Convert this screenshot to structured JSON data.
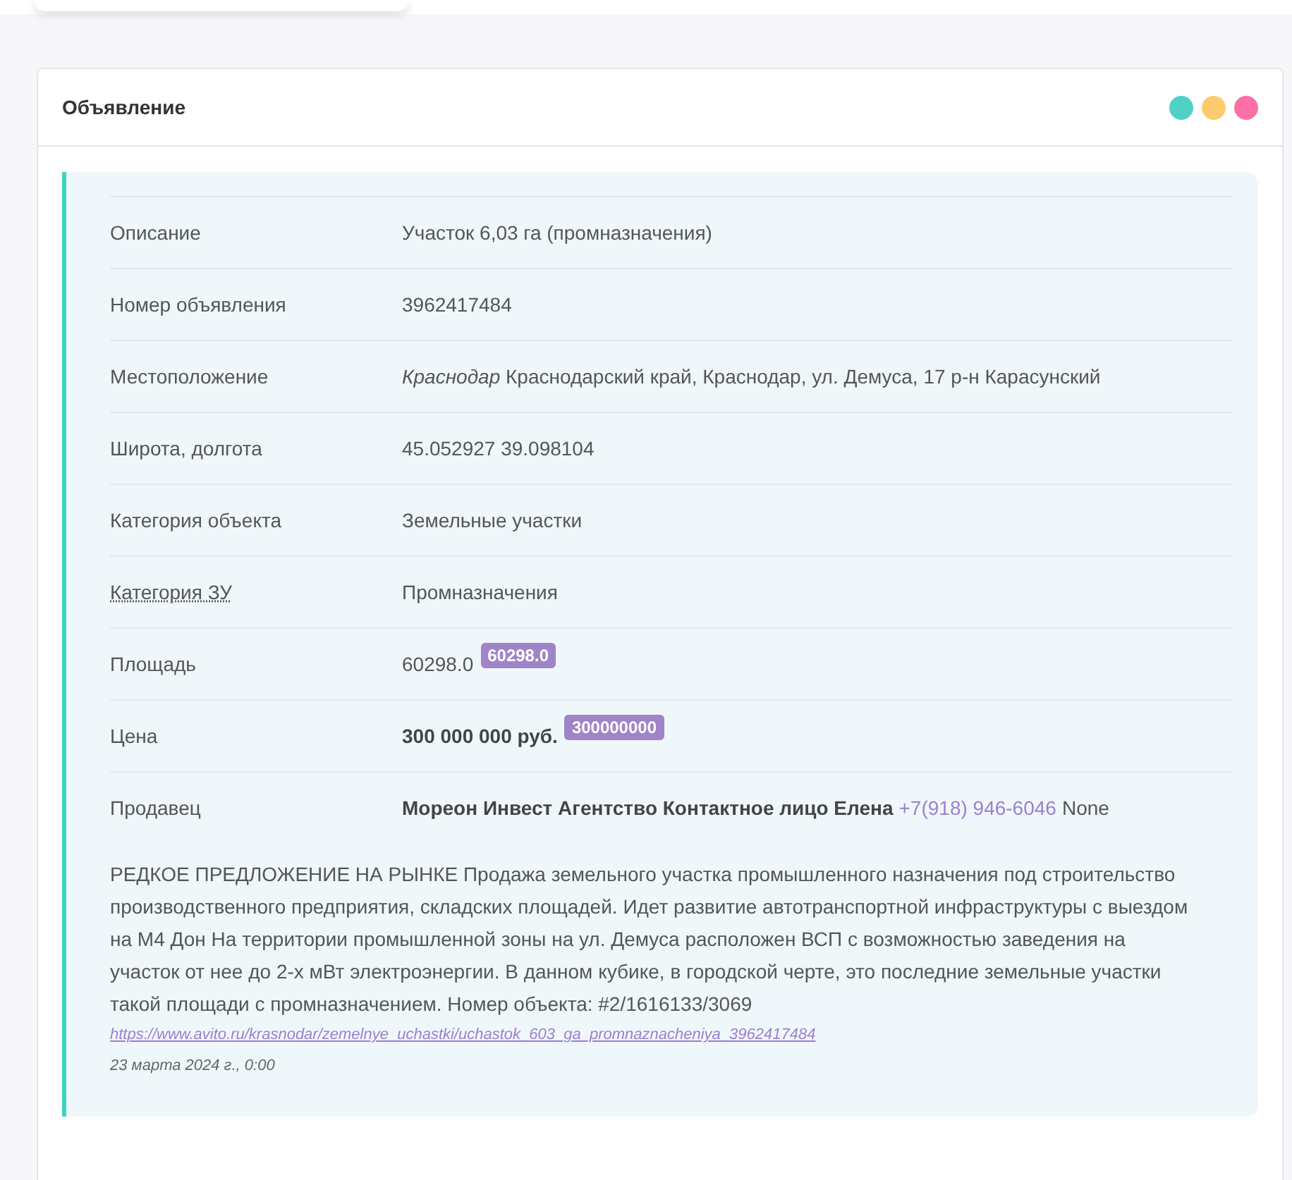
{
  "card": {
    "title": "Объявление",
    "dots": [
      {
        "color": "#4fd1c5"
      },
      {
        "color": "#fdcb6e"
      },
      {
        "color": "#fd6fa6"
      }
    ]
  },
  "rows": [
    {
      "kind": "text",
      "label": "Описание",
      "value": "Участок 6,03 га (промназначения)"
    },
    {
      "kind": "text",
      "label": "Номер объявления",
      "value": "3962417484"
    },
    {
      "kind": "rich",
      "label": "Местоположение",
      "value": "*Краснодар* Краснодарский край, Краснодар, ул. Демуса, 17 р-н Карасунский"
    },
    {
      "kind": "text",
      "label": "Широта, долгота",
      "value": "45.052927 39.098104"
    },
    {
      "kind": "text",
      "label": "Категория объекта",
      "value": "Земельные участки"
    },
    {
      "kind": "text",
      "label": "Категория ЗУ",
      "label_hint": true,
      "value": "Промназначения"
    },
    {
      "kind": "badge",
      "label": "Площадь",
      "value": "60298.0",
      "badge": "60298.0"
    },
    {
      "kind": "badge",
      "label": "Цена",
      "value": "300 000 000 руб.",
      "bold": true,
      "badge": "300000000"
    },
    {
      "kind": "seller",
      "label": "Продавец",
      "value": "Мореон Инвест Агентство Контактное лицо Елена",
      "phone": "+7(918) 946-6046",
      "suffix": "None"
    }
  ],
  "description": "РЕДКОЕ ПРЕДЛОЖЕНИЕ НА РЫНКЕ Продажа земельного участка промышленного назначения под строительство производственного предприятия, складских площадей. Идет развитие автотранспортной инфраструктуры с выездом на М4 Дон На территории промышленной зоны на ул. Демуса расположен ВСП с возможностью заведения на участок от нее до 2-х мВт электроэнергии. В данном кубике, в городской черте, это последние земельные участки такой площади с промназначением. Номер объекта: #2/1616133/3069",
  "url": "https://www.avito.ru/krasnodar/zemelnye_uchastki/uchastok_603_ga_promnaznacheniya_3962417484",
  "date": "23 марта 2024 г., 0:00"
}
